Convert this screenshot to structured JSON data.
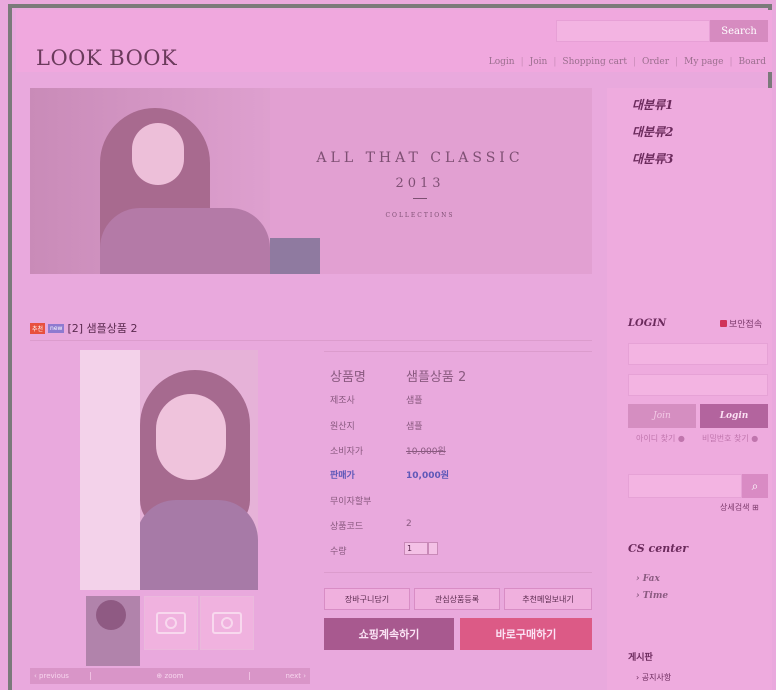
{
  "header": {
    "logo": "LOOK BOOK",
    "search_button": "Search",
    "nav": [
      "Login",
      "Join",
      "Shopping cart",
      "Order",
      "My page",
      "Board"
    ]
  },
  "banner": {
    "line1": "ALL THAT CLASSIC",
    "line2": "2013",
    "line3": "COLLECTIONS"
  },
  "product": {
    "badges": [
      "추천",
      "new"
    ],
    "title": "[2] 샘플상품 2",
    "rows": [
      {
        "label": "상품명",
        "value": "샘플상품 2"
      },
      {
        "label": "제조사",
        "value": "샘플"
      },
      {
        "label": "원산지",
        "value": "샘플"
      },
      {
        "label": "소비자가",
        "value": "10,000원"
      },
      {
        "label": "판매가",
        "value": "10,000원"
      },
      {
        "label": "무이자할부",
        "value": ""
      },
      {
        "label": "상품코드",
        "value": "2"
      },
      {
        "label": "수량",
        "value": ""
      }
    ],
    "quantity": "1",
    "buttons": {
      "cart": "장바구니담기",
      "wish": "관심상품등록",
      "recommend": "추천메일보내기"
    },
    "continue_shopping": "쇼핑계속하기",
    "buy_now": "바로구매하기",
    "pager": {
      "previous": "previous",
      "zoom": "zoom",
      "next": "next"
    }
  },
  "sidebar": {
    "categories": [
      "대분류1",
      "대분류2",
      "대분류3"
    ],
    "login_title": "LOGIN",
    "secure_login": "보안접속",
    "join": "Join",
    "login": "Login",
    "find_id": "아이디 찾기",
    "find_pw": "비밀번호 찾기",
    "advanced_search": "상세검색",
    "cs_center": "CS center",
    "cs_items": [
      "Fax",
      "Time"
    ],
    "board_title": "게시판",
    "board_items": [
      "공지사항"
    ]
  },
  "colors": {
    "background": "#e9a9dd",
    "frame": "#7a7a7a",
    "continue_btn": "#a8598f",
    "buy_btn": "#dc5a86",
    "sale_text": "#5e58b8"
  }
}
